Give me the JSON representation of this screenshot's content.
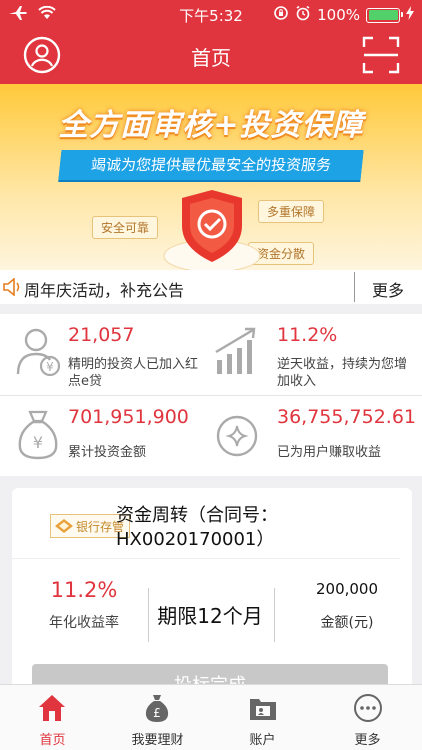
{
  "status_bar": {
    "time": "下午5:32",
    "battery": "100%"
  },
  "nav": {
    "title": "首页"
  },
  "banner": {
    "headline": "全方面审核+投资保障",
    "subtitle": "竭诚为您提供最优最安全的投资服务",
    "tags": [
      "安全可靠",
      "多重保障",
      "资金分散"
    ]
  },
  "notice": {
    "text": "周年庆活动，补充公告",
    "more": "更多"
  },
  "stats": [
    {
      "value": "21,057",
      "desc": "精明的投资人已加入红点e贷",
      "icon": "investor-icon"
    },
    {
      "value": "11.2%",
      "desc": "逆天收益，持续为您增加收入",
      "icon": "growth-chart-icon"
    },
    {
      "value": "701,951,900",
      "desc": "累计投资金额",
      "icon": "money-bag-icon"
    },
    {
      "value": "36,755,752.61",
      "desc": "已为用户赚取收益",
      "icon": "earnings-icon"
    }
  ],
  "product": {
    "badge": "银行存管",
    "title": "资金周转（合同号：HX0020170001）",
    "rate": "11.2%",
    "rate_label": "年化收益率",
    "term": "期限12个月",
    "amount": "200,000",
    "amount_label": "金额(元)",
    "button": "投标完成"
  },
  "tabs": [
    {
      "label": "首页",
      "icon": "home-icon"
    },
    {
      "label": "我要理财",
      "icon": "money-bag-icon"
    },
    {
      "label": "账户",
      "icon": "account-folder-icon"
    },
    {
      "label": "更多",
      "icon": "more-icon"
    }
  ],
  "colors": {
    "brand": "#e0353e",
    "banner": "#ffc93a",
    "ribbon": "#1ea2e6"
  }
}
